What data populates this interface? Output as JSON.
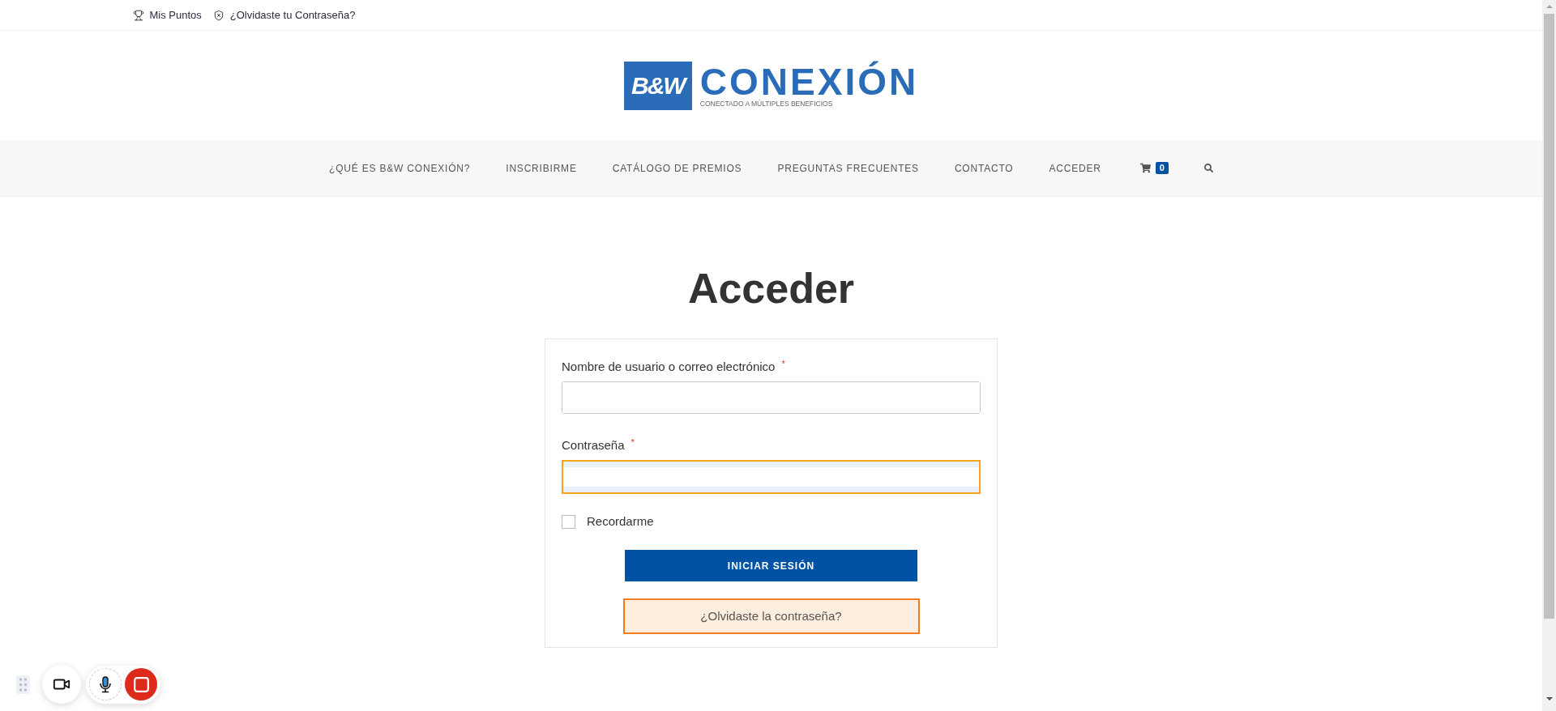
{
  "top_bar": {
    "points_link": {
      "label": "Mis Puntos"
    },
    "password_link": {
      "label": "¿Olvidaste tu Contraseña?"
    }
  },
  "logo": {
    "mark": "B&W",
    "wordmark": "CONEXIÓN",
    "tagline": "CONECTADO A MÚLTIPLES BENEFICIOS"
  },
  "nav": {
    "items": [
      {
        "label": "¿QUÉ ES B&W CONEXIÓN?"
      },
      {
        "label": "INSCRIBIRME"
      },
      {
        "label": "CATÁLOGO DE PREMIOS"
      },
      {
        "label": "PREGUNTAS FRECUENTES"
      },
      {
        "label": "CONTACTO"
      },
      {
        "label": "ACCEDER"
      }
    ],
    "cart_count": "0"
  },
  "page_title": "Acceder",
  "login_form": {
    "fields": [
      {
        "label": "Nombre de usuario o correo electrónico",
        "required_mark": "*",
        "highlighted": false,
        "autofilled": false
      },
      {
        "label": "Contraseña",
        "required_mark": "*",
        "highlighted": true,
        "autofilled": true
      }
    ],
    "remember": {
      "label": "Recordarme",
      "checked": false
    },
    "submit": {
      "label": "INICIAR SESIÓN"
    },
    "forgot_link": {
      "label": "¿Olvidaste la contraseña?",
      "highlighted": true
    }
  }
}
